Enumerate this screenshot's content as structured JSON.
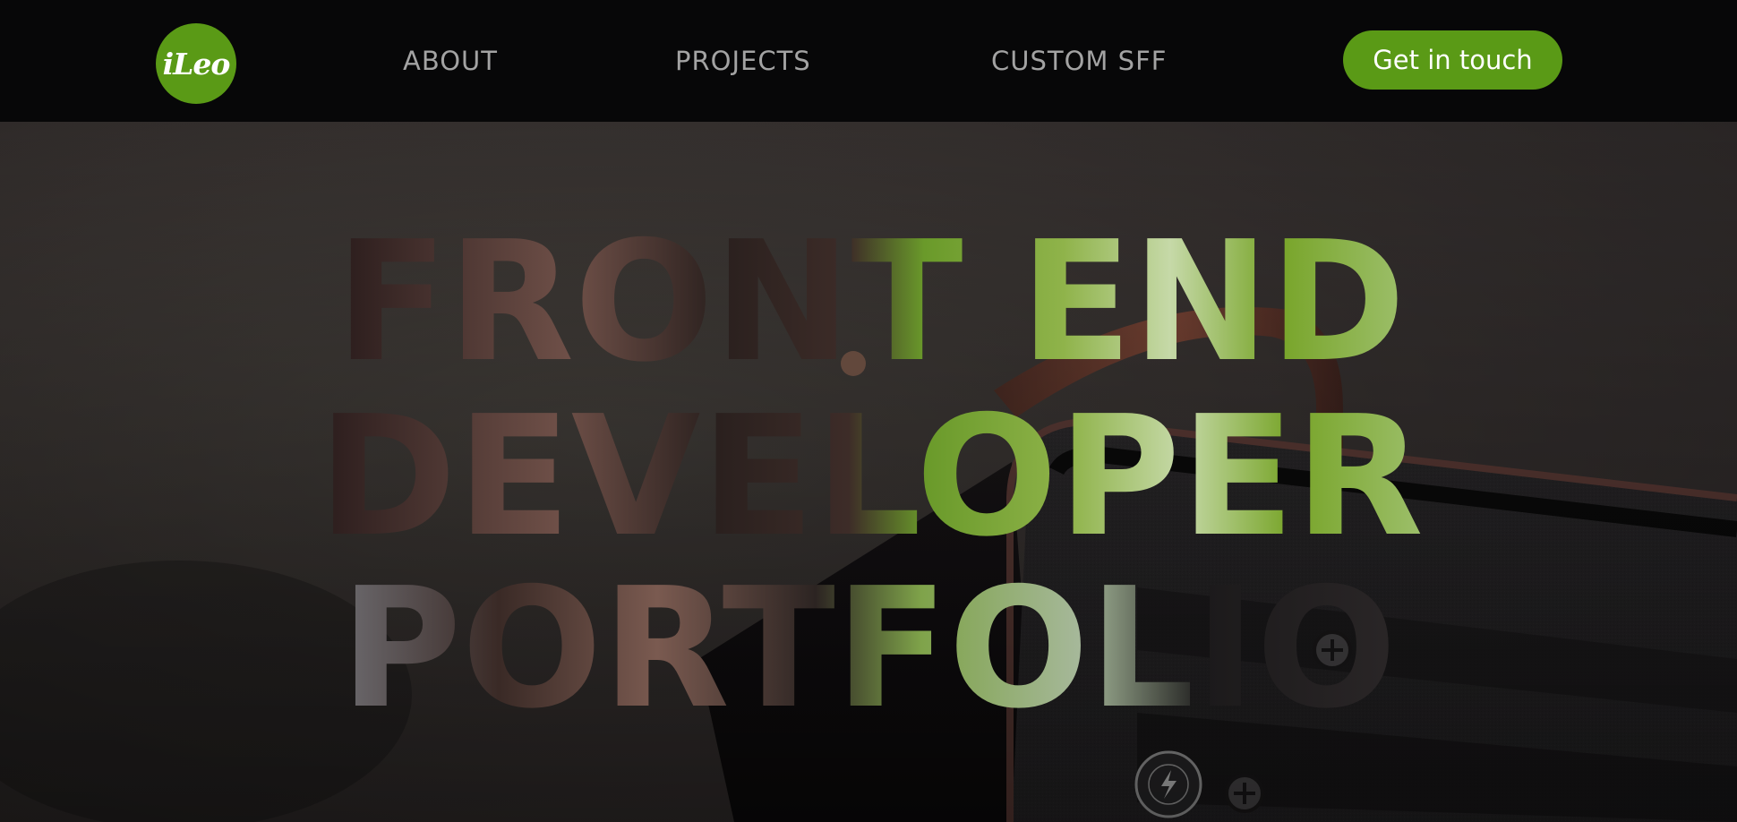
{
  "brand": {
    "logo_text": "iLeo",
    "accent_color": "#5a9a16"
  },
  "nav": {
    "items": [
      {
        "label": "ABOUT"
      },
      {
        "label": "PROJECTS"
      },
      {
        "label": "CUSTOM SFF"
      }
    ],
    "cta_label": "Get in touch"
  },
  "hero": {
    "title_lines": [
      "FRONT END",
      "DEVELOPER",
      "PORTFOLIO"
    ],
    "background": "photo of a small form factor PC case"
  }
}
